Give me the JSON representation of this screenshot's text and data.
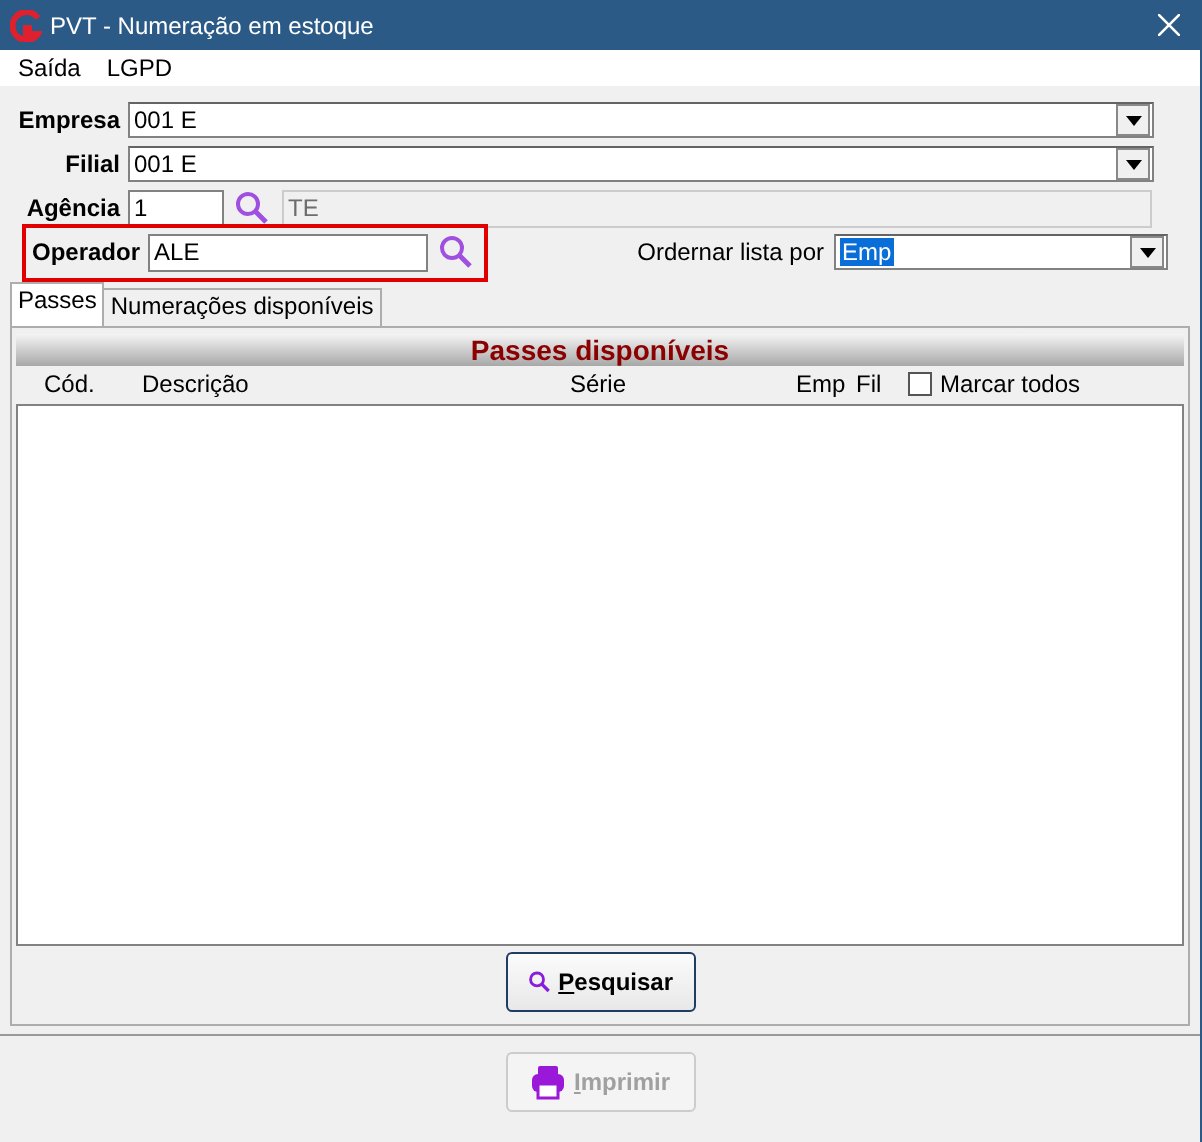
{
  "window": {
    "title": "PVT - Numeração em estoque"
  },
  "menu": [
    {
      "label": "Saída"
    },
    {
      "label": "LGPD"
    }
  ],
  "fields": [
    {
      "kind": "combo",
      "label": "Empresa",
      "value": "001 E"
    },
    {
      "kind": "combo",
      "label": "Filial",
      "value": "001 E"
    },
    {
      "kind": "lookup",
      "label": "Agência",
      "value": "1",
      "description": "TE"
    },
    {
      "kind": "search",
      "label": "Operador",
      "value": "ALE",
      "highlighted": true
    }
  ],
  "sort": {
    "label": "Ordernar lista por",
    "value": "Emp"
  },
  "tabs": [
    {
      "label": "Passes",
      "selected": true
    },
    {
      "label": "Numerações disponíveis",
      "selected": false
    }
  ],
  "panel": {
    "title": "Passes disponíveis",
    "columns": [
      "Cód.",
      "Descrição",
      "Série",
      "Emp",
      "Fil"
    ],
    "select_all": {
      "label": "Marcar todos",
      "checked": false
    }
  },
  "buttons": [
    {
      "kind": "search",
      "label": "Pesquisar",
      "disabled": false
    },
    {
      "kind": "print",
      "label": "Imprimir",
      "disabled": true
    }
  ]
}
